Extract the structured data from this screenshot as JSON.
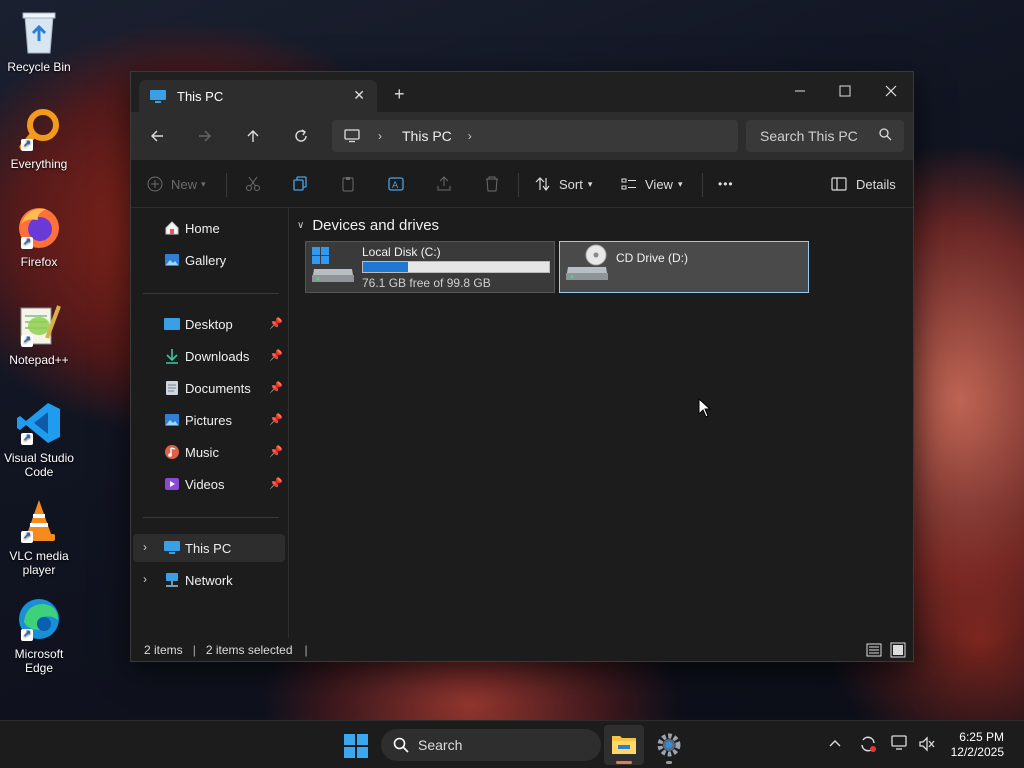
{
  "desktop": {
    "icons": [
      {
        "label": "Recycle Bin"
      },
      {
        "label": "Everything"
      },
      {
        "label": "Firefox"
      },
      {
        "label": "Notepad++"
      },
      {
        "label": "Visual Studio Code"
      },
      {
        "label": "VLC media player"
      },
      {
        "label": "Microsoft Edge"
      }
    ]
  },
  "window": {
    "tab_title": "This PC",
    "new_tab_symbol": "+",
    "address_segments": [
      "This PC"
    ],
    "search_placeholder": "Search This PC",
    "toolbar": {
      "new_label": "New",
      "sort_label": "Sort",
      "view_label": "View",
      "more_label": "•••",
      "details_label": "Details"
    },
    "sidebar": {
      "items": [
        {
          "label": "Home"
        },
        {
          "label": "Gallery"
        },
        {
          "label": "Desktop"
        },
        {
          "label": "Downloads"
        },
        {
          "label": "Documents"
        },
        {
          "label": "Pictures"
        },
        {
          "label": "Music"
        },
        {
          "label": "Videos"
        },
        {
          "label": "This PC"
        },
        {
          "label": "Network"
        }
      ]
    },
    "content": {
      "group_title": "Devices and drives",
      "drives": [
        {
          "name": "Local Disk (C:)",
          "free_text": "76.1 GB free of 99.8 GB",
          "used_fraction": 0.24
        },
        {
          "name": "CD Drive (D:)"
        }
      ]
    },
    "status": {
      "items_count": "2 items",
      "selected_count": "2 items selected"
    }
  },
  "taskbar": {
    "search_label": "Search",
    "time": "6:25 PM",
    "date": "12/2/2025"
  },
  "colors": {
    "accent": "#1f78d1",
    "selection_border": "#99c9ef"
  }
}
